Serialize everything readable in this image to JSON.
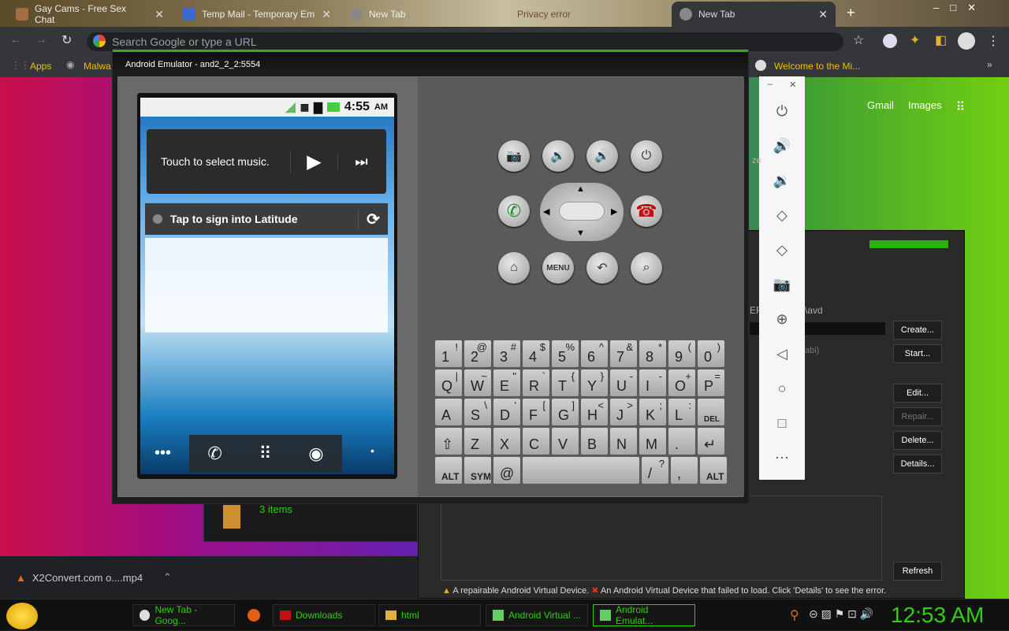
{
  "browser": {
    "tabs": [
      {
        "title": "Gay Cams - Free Sex Chat",
        "color": "#a07040"
      },
      {
        "title": "Temp Mail - Temporary Em",
        "color": "#3a6ad0"
      },
      {
        "title": "New Tab",
        "color": "#888888"
      },
      {
        "title": "Privacy error",
        "color": "#c03030"
      },
      {
        "title": "New Tab",
        "color": "#888888",
        "active": true
      }
    ],
    "omnibox_placeholder": "Search Google or type a URL",
    "bookmarks": [
      {
        "label": "Apps"
      },
      {
        "label": "Malwa"
      }
    ],
    "second_bookmark": "Welcome to the Mi...",
    "google_links": [
      "Gmail",
      "Images"
    ]
  },
  "emulator": {
    "title": "Android Emulator - and2_2_2:5554",
    "time": "4:55",
    "ampm": "AM",
    "music_text": "Touch to select music.",
    "latitude_text": "Tap to sign into Latitude",
    "keyboard_rows": [
      [
        [
          "1",
          "!"
        ],
        [
          "2",
          "@"
        ],
        [
          "3",
          "#"
        ],
        [
          "4",
          "$"
        ],
        [
          "5",
          "%"
        ],
        [
          "6",
          "^"
        ],
        [
          "7",
          "&"
        ],
        [
          "8",
          "*"
        ],
        [
          "9",
          "("
        ],
        [
          "0",
          ")"
        ]
      ],
      [
        [
          "Q",
          "|"
        ],
        [
          "W",
          "~"
        ],
        [
          "E",
          "\""
        ],
        [
          "R",
          "`"
        ],
        [
          "T",
          "{"
        ],
        [
          "Y",
          "}"
        ],
        [
          "U",
          "-"
        ],
        [
          "I",
          "-"
        ],
        [
          "O",
          "+"
        ],
        [
          "P",
          "="
        ]
      ],
      [
        [
          "A",
          ""
        ],
        [
          "S",
          "\\"
        ],
        [
          "D",
          "'"
        ],
        [
          "F",
          "["
        ],
        [
          "G",
          "]"
        ],
        [
          "H",
          "<"
        ],
        [
          "J",
          ">"
        ],
        [
          "K",
          ";"
        ],
        [
          "L",
          ":"
        ],
        [
          "DEL",
          ""
        ]
      ],
      [
        [
          "⇧",
          ""
        ],
        [
          "Z",
          ""
        ],
        [
          "X",
          ""
        ],
        [
          "C",
          ""
        ],
        [
          "V",
          ""
        ],
        [
          "B",
          ""
        ],
        [
          "N",
          ""
        ],
        [
          "M",
          ""
        ],
        [
          ".",
          ""
        ],
        [
          "↵",
          ""
        ]
      ],
      [
        [
          "ALT",
          ""
        ],
        [
          "SYM",
          ""
        ],
        [
          "@",
          ""
        ],
        [
          "",
          ""
        ],
        [
          "/",
          "?"
        ],
        [
          ",",
          ""
        ],
        [
          "ALT",
          ""
        ]
      ]
    ],
    "menu_label": "MENU"
  },
  "avd_manager": {
    "path_text": "\\avd",
    "abi_text": "abi)",
    "buttons": [
      "Create...",
      "Start...",
      "Edit...",
      "Repair...",
      "Delete...",
      "Details...",
      "Refresh"
    ],
    "status_repairable": "A repairable Android Virtual Device.",
    "status_failed": "An Android Virtual Device that failed to load. Click 'Details' to see the error.",
    "truncated_letters": "EF",
    "zoom_fragment": "ze"
  },
  "files": {
    "items_count": "3 items"
  },
  "download": {
    "filename": "X2Convert.com o....mp4"
  },
  "taskbar": {
    "items": [
      {
        "label": "New Tab - Goog...",
        "icon": "chrome-icon"
      },
      {
        "label": "",
        "icon": "firefox-icon"
      },
      {
        "label": "Downloads",
        "icon": "folder-icon"
      },
      {
        "label": "html",
        "icon": "folder-icon"
      },
      {
        "label": "Android Virtual ...",
        "icon": "android-icon"
      },
      {
        "label": "Android Emulat...",
        "icon": "android-icon"
      }
    ],
    "clock": "12:53 AM"
  }
}
